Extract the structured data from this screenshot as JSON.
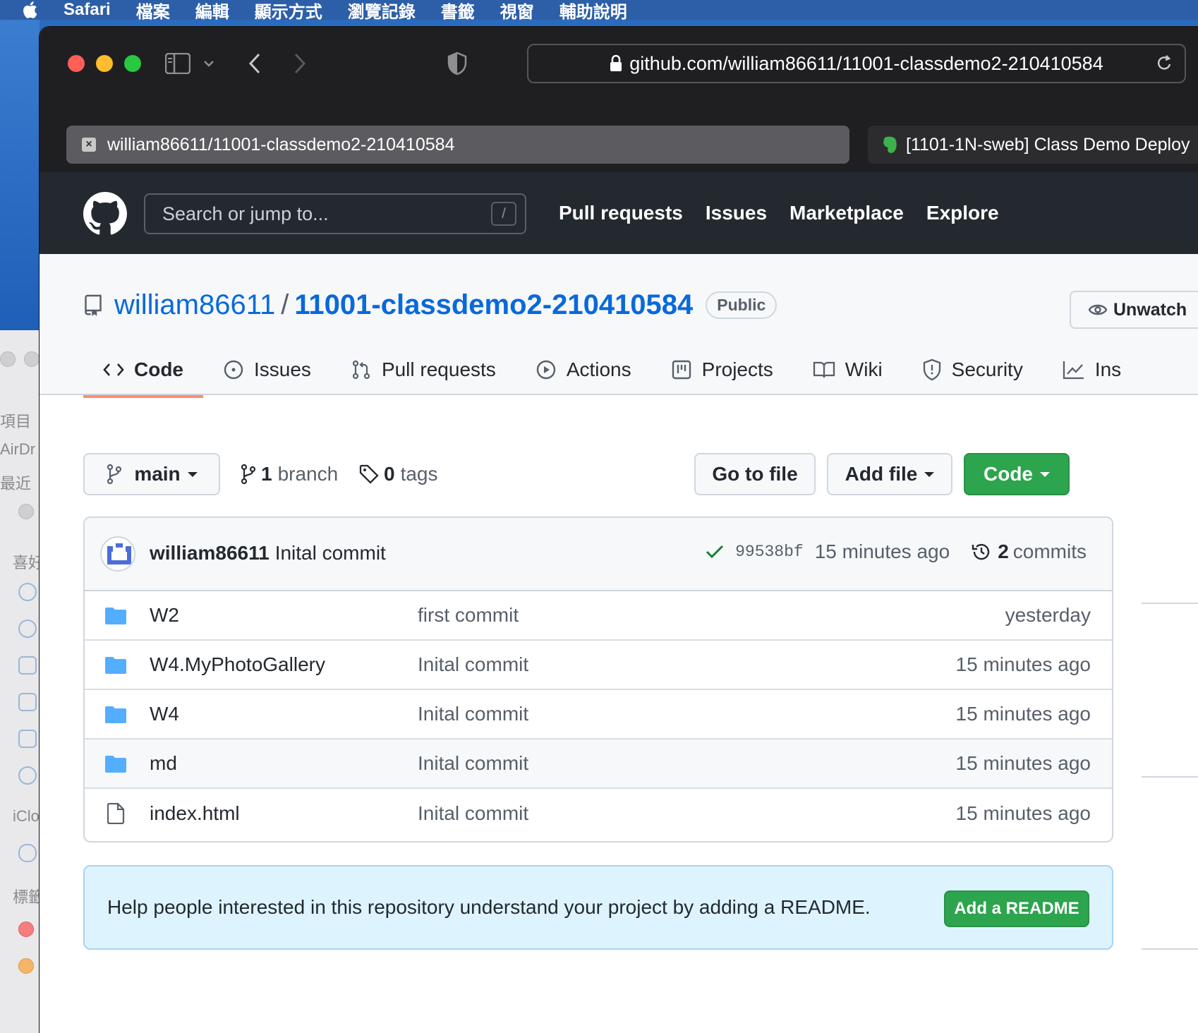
{
  "menubar": {
    "items": [
      "Safari",
      "檔案",
      "編輯",
      "顯示方式",
      "瀏覽記錄",
      "書籤",
      "視窗",
      "輔助說明"
    ]
  },
  "finder_peek": {
    "labels": [
      "項目",
      "AirDr",
      "最近",
      "喜好",
      "iClo",
      "標籤"
    ]
  },
  "browser": {
    "url": "github.com/william86611/11001-classdemo2-210410584",
    "tabs": [
      {
        "title": "william86611/11001-classdemo2-210410584",
        "active": true
      },
      {
        "title": "[1101-1N-sweb] Class Demo Deploy",
        "active": false
      }
    ]
  },
  "github_header": {
    "search_placeholder": "Search or jump to...",
    "search_shortcut": "/",
    "nav": [
      "Pull requests",
      "Issues",
      "Marketplace",
      "Explore"
    ]
  },
  "repo": {
    "owner": "william86611",
    "separator": "/",
    "name": "11001-classdemo2-210410584",
    "visibility": "Public",
    "watch_label": "Unwatch",
    "tabs": [
      {
        "label": "Code",
        "icon": "code-icon",
        "selected": true
      },
      {
        "label": "Issues",
        "icon": "issue-icon"
      },
      {
        "label": "Pull requests",
        "icon": "pull-request-icon"
      },
      {
        "label": "Actions",
        "icon": "play-icon"
      },
      {
        "label": "Projects",
        "icon": "project-icon"
      },
      {
        "label": "Wiki",
        "icon": "book-icon"
      },
      {
        "label": "Security",
        "icon": "shield-icon"
      },
      {
        "label": "Ins",
        "icon": "graph-icon"
      }
    ]
  },
  "controls": {
    "branch": "main",
    "branch_count": "1",
    "branch_word": "branch",
    "tag_count": "0",
    "tag_word": "tags",
    "go_to_file": "Go to file",
    "add_file": "Add file",
    "code": "Code"
  },
  "latest_commit": {
    "author": "william86611",
    "message": "Inital commit",
    "hash": "99538bf",
    "age": "15 minutes ago",
    "commit_count": "2",
    "commit_word": "commits"
  },
  "files": [
    {
      "name": "W2",
      "type": "folder",
      "message": "first commit",
      "age": "yesterday"
    },
    {
      "name": "W4.MyPhotoGallery",
      "type": "folder",
      "message": "Inital commit",
      "age": "15 minutes ago"
    },
    {
      "name": "W4",
      "type": "folder",
      "message": "Inital commit",
      "age": "15 minutes ago"
    },
    {
      "name": "md",
      "type": "folder",
      "message": "Inital commit",
      "age": "15 minutes ago"
    },
    {
      "name": "index.html",
      "type": "file",
      "message": "Inital commit",
      "age": "15 minutes ago"
    }
  ],
  "readme_banner": {
    "text": "Help people interested in this repository understand your project by adding a README.",
    "button": "Add a README"
  },
  "colors": {
    "accent_blue": "#0969da",
    "github_green": "#2da44e",
    "header_dark": "#24292f",
    "tab_underline": "#fd8c73",
    "folder_blue": "#54aeff"
  }
}
